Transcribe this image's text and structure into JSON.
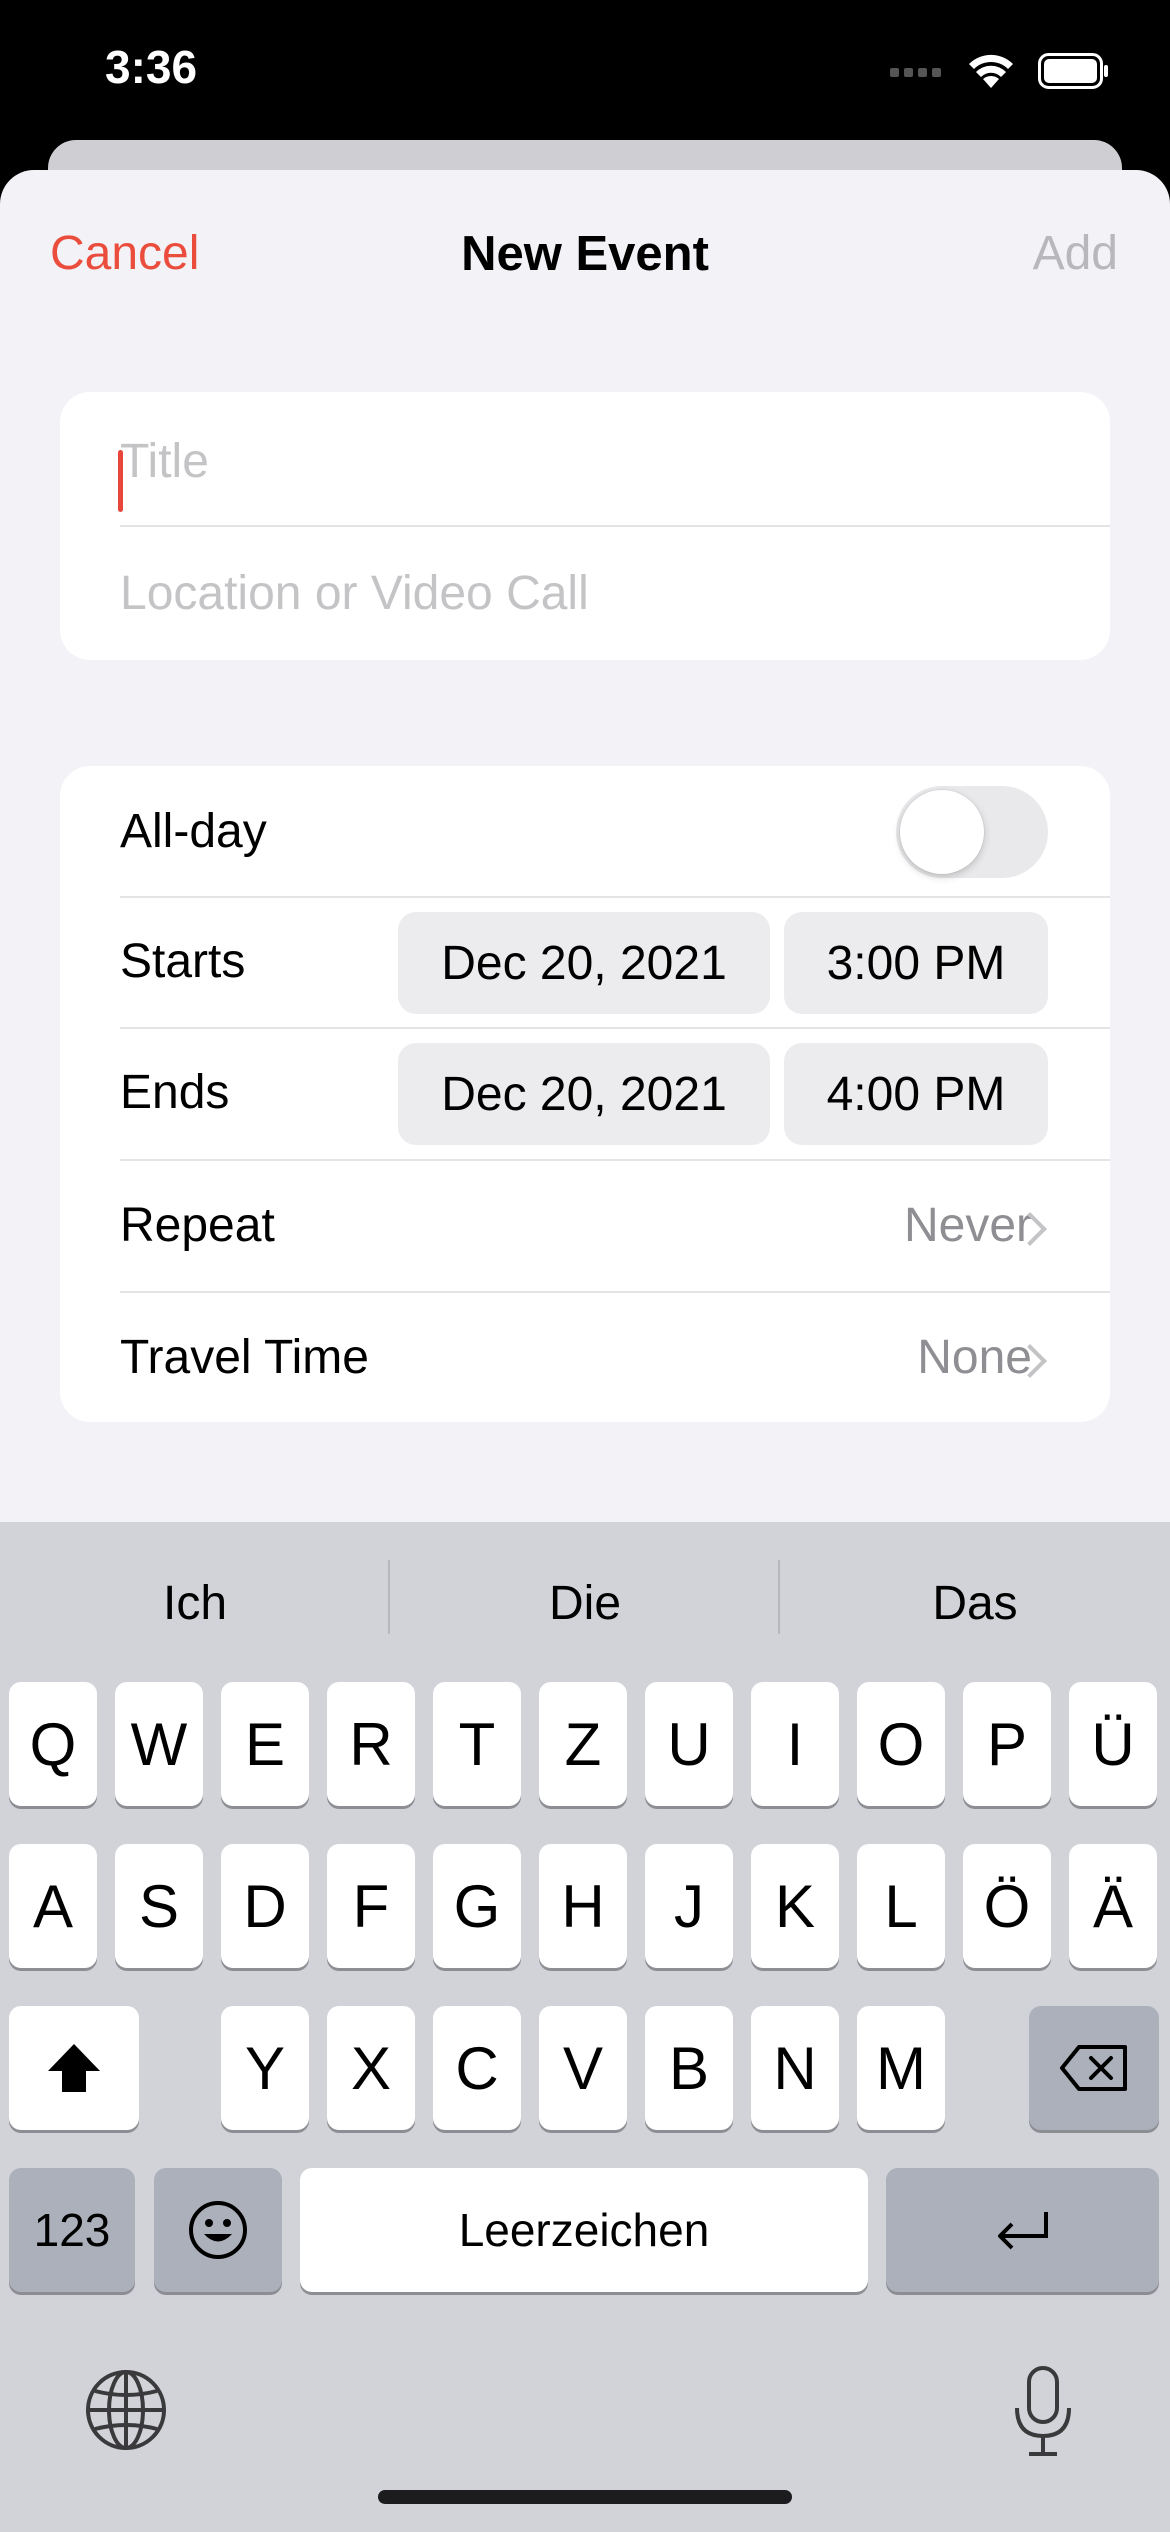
{
  "status_bar": {
    "time": "3:36"
  },
  "nav": {
    "cancel": "Cancel",
    "title": "New Event",
    "add": "Add"
  },
  "form": {
    "title_placeholder": "Title",
    "location_placeholder": "Location or Video Call",
    "all_day_label": "All-day",
    "all_day_on": false,
    "starts_label": "Starts",
    "starts_date": "Dec 20, 2021",
    "starts_time": "3:00 PM",
    "ends_label": "Ends",
    "ends_date": "Dec 20, 2021",
    "ends_time": "4:00 PM",
    "repeat_label": "Repeat",
    "repeat_value": "Never",
    "travel_label": "Travel Time",
    "travel_value": "None"
  },
  "keyboard": {
    "suggestions": [
      "Ich",
      "Die",
      "Das"
    ],
    "row1": [
      "Q",
      "W",
      "E",
      "R",
      "T",
      "Z",
      "U",
      "I",
      "O",
      "P",
      "Ü"
    ],
    "row2": [
      "A",
      "S",
      "D",
      "F",
      "G",
      "H",
      "J",
      "K",
      "L",
      "Ö",
      "Ä"
    ],
    "row3": [
      "Y",
      "X",
      "C",
      "V",
      "B",
      "N",
      "M"
    ],
    "numbers_key": "123",
    "space_key": "Leerzeichen",
    "icons": [
      "shift-icon",
      "backspace-icon",
      "emoji-icon",
      "return-icon",
      "globe-icon",
      "microphone-icon"
    ]
  }
}
